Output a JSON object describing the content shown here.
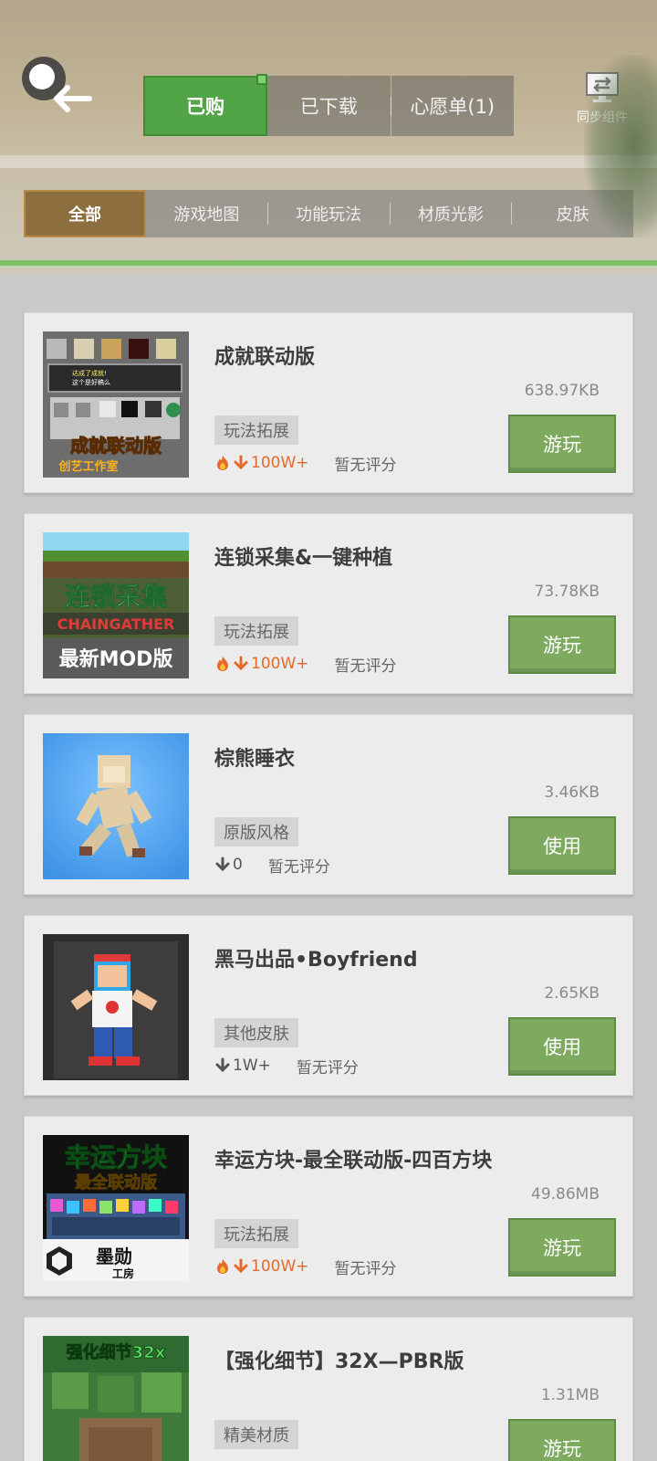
{
  "header": {
    "tabs": [
      {
        "label": "已购",
        "active": true
      },
      {
        "label": "已下载"
      },
      {
        "label": "心愿单(1)"
      }
    ],
    "sync_label": "同步组件",
    "back_icon": "back-arrow-icon",
    "sync_icon": "sync-monitor-icon"
  },
  "categories": [
    "全部",
    "游戏地图",
    "功能玩法",
    "材质光影",
    "皮肤"
  ],
  "colors": {
    "accent_green": "#52a547",
    "button_green": "#7daa5f",
    "active_category": "#8d6e3e",
    "hot_orange": "#e46a2b"
  },
  "items": [
    {
      "title": "成就联动版",
      "size": "638.97KB",
      "tag": "玩法拓展",
      "downloads": "100W+",
      "hot": true,
      "rating": "暂无评分",
      "action": "游玩",
      "thumb_text": "成就联动版",
      "thumb_sub": "创艺工作室",
      "thumb_popup": "达成了成就!",
      "thumb_popup2": "这个是好稿么"
    },
    {
      "title": "连锁采集&一键种植",
      "size": "73.78KB",
      "tag": "玩法拓展",
      "downloads": "100W+",
      "hot": true,
      "rating": "暂无评分",
      "action": "游玩",
      "thumb_text": "连锁采集",
      "thumb_sub": "CHAINGATHER",
      "thumb_sub2": "最新MOD版"
    },
    {
      "title": "棕熊睡衣",
      "size": "3.46KB",
      "tag": "原版风格",
      "downloads": "0",
      "hot": false,
      "rating": "暂无评分",
      "action": "使用"
    },
    {
      "title": "黑马出品•Boyfriend",
      "size": "2.65KB",
      "tag": "其他皮肤",
      "downloads": "1W+",
      "hot": false,
      "rating": "暂无评分",
      "action": "使用"
    },
    {
      "title": "幸运方块-最全联动版-四百方块",
      "size": "49.86MB",
      "tag": "玩法拓展",
      "downloads": "100W+",
      "hot": true,
      "rating": "暂无评分",
      "action": "游玩",
      "thumb_text": "幸运方块",
      "thumb_sub": "最全联动版",
      "thumb_sub2": "墨勋",
      "thumb_sub3": "工房"
    },
    {
      "title": "【强化细节】32X—PBR版",
      "size": "1.31MB",
      "tag": "精美材质",
      "downloads": "",
      "hot": false,
      "rating": "",
      "action": "游玩",
      "thumb_text": "强化细节32x"
    }
  ]
}
